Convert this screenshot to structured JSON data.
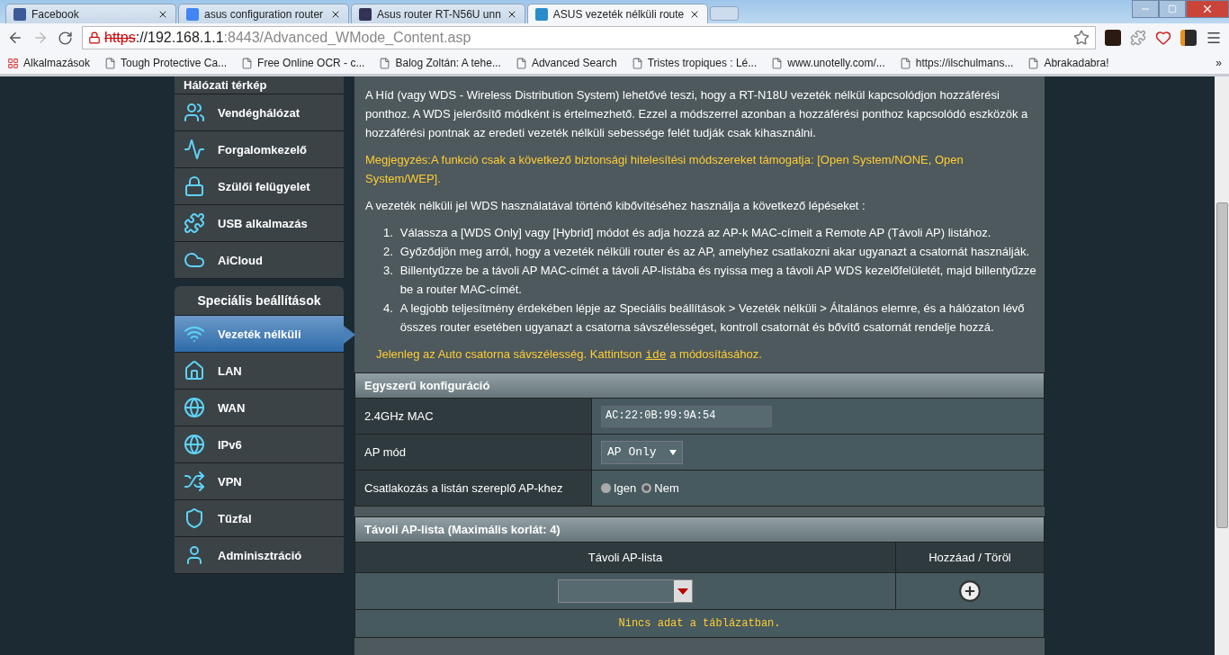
{
  "browser": {
    "tabs": [
      {
        "title": "Facebook",
        "selected": false
      },
      {
        "title": "asus configuration router",
        "selected": false
      },
      {
        "title": "Asus router RT-N56U unn",
        "selected": false
      },
      {
        "title": "ASUS vezeték nélküli route",
        "selected": true
      }
    ],
    "address": {
      "scheme": "https",
      "host": "://192.168.1.1",
      "path": ":8443/Advanced_WMode_Content.asp",
      "secure": false
    },
    "bookmarks": [
      {
        "label": "Alkalmazások"
      },
      {
        "label": "Tough Protective Ca..."
      },
      {
        "label": "Free Online OCR - c..."
      },
      {
        "label": "Balog Zoltán: A tehe..."
      },
      {
        "label": "Advanced Search"
      },
      {
        "label": "Tristes tropiques : Lé..."
      },
      {
        "label": "www.unotelly.com/..."
      },
      {
        "label": "https://ilschulmans..."
      },
      {
        "label": "Abrakadabra!"
      }
    ],
    "bookmarks_more": "»"
  },
  "sidebar": {
    "general_items": [
      {
        "label": "Hálózati térkép",
        "selected": false
      },
      {
        "label": "Vendéghálózat",
        "selected": false
      },
      {
        "label": "Forgalomkezelő",
        "selected": false
      },
      {
        "label": "Szülői felügyelet",
        "selected": false
      },
      {
        "label": "USB alkalmazás",
        "selected": false
      },
      {
        "label": "AiCloud",
        "selected": false
      }
    ],
    "section_title": "Speciális beállítások",
    "advanced_items": [
      {
        "label": "Vezeték nélküli",
        "selected": true
      },
      {
        "label": "LAN",
        "selected": false
      },
      {
        "label": "WAN",
        "selected": false
      },
      {
        "label": "IPv6",
        "selected": false
      },
      {
        "label": "VPN",
        "selected": false
      },
      {
        "label": "Tűzfal",
        "selected": false
      },
      {
        "label": "Adminisztráció",
        "selected": false
      }
    ]
  },
  "content": {
    "intro": "A Híd (vagy WDS - Wireless Distribution System) lehetővé teszi, hogy a RT-N18U vezeték nélkül kapcsolódjon hozzáférési ponthoz. A WDS jelerősítő módként is értelmezhető. Ezzel a módszerrel azonban a hozzáférési ponthoz kapcsolódó eszközök a hozzáférési pontnak az eredeti vezeték nélküli sebessége felét tudják csak kihasználni.",
    "note": "Megjegyzés:A funkció csak a következő biztonsági hitelesítési módszereket támogatja: [Open System/NONE, Open System/WEP].",
    "steps_intro": "A vezeték nélküli jel WDS használatával történő kibővítéséhez használja a következő lépéseket :",
    "steps": [
      {
        "number": "1.",
        "text": "Válassza a [WDS Only] vagy [Hybrid] módot és adja hozzá az AP-k MAC-címeit a Remote AP (Távoli AP) listához."
      },
      {
        "number": "2.",
        "text": "Győződjön meg arról, hogy a vezeték nélküli router és az AP, amelyhez csatlakozni akar ugyanazt a csatornát használják."
      },
      {
        "number": "3.",
        "text": "Billentyűzze be a távoli AP MAC-címét a távoli AP-listába és nyissa meg a távoli AP WDS kezelőfelületét, majd billentyűzze be a router MAC-címét."
      },
      {
        "number": "4.",
        "text": "A legjobb teljesítmény érdekében lépje az Speciális beállítások > Vezeték nélküli > Általános elemre, és a hálózaton lévő összes router esetében ugyanazt a csatorna sávszélességet, kontroll csatornát és bővítő csatornát rendelje hozzá."
      }
    ],
    "notice": {
      "before": "Jelenleg az Auto csatorna sávszélesség. Kattintson ",
      "link": "ide",
      "after": " a módosításához."
    }
  },
  "basic_config": {
    "title": "Egyszerű konfiguráció",
    "rows": [
      {
        "kind": "text",
        "label": "2.4GHz MAC",
        "value": "AC:22:0B:99:9A:54"
      },
      {
        "kind": "select",
        "label": "AP mód",
        "value": "AP Only"
      },
      {
        "kind": "radio",
        "label": "Csatlakozás a listán szereplő AP-khez",
        "options": [
          {
            "label": "Igen",
            "selected": false
          },
          {
            "label": "Nem",
            "selected": true
          }
        ]
      }
    ]
  },
  "remote_list": {
    "title": "Távoli AP-lista (Maximális korlát: 4)",
    "columns": [
      "Távoli AP-lista",
      "Hozzáad / Töröl"
    ],
    "empty_message": "Nincs adat a táblázatban."
  }
}
